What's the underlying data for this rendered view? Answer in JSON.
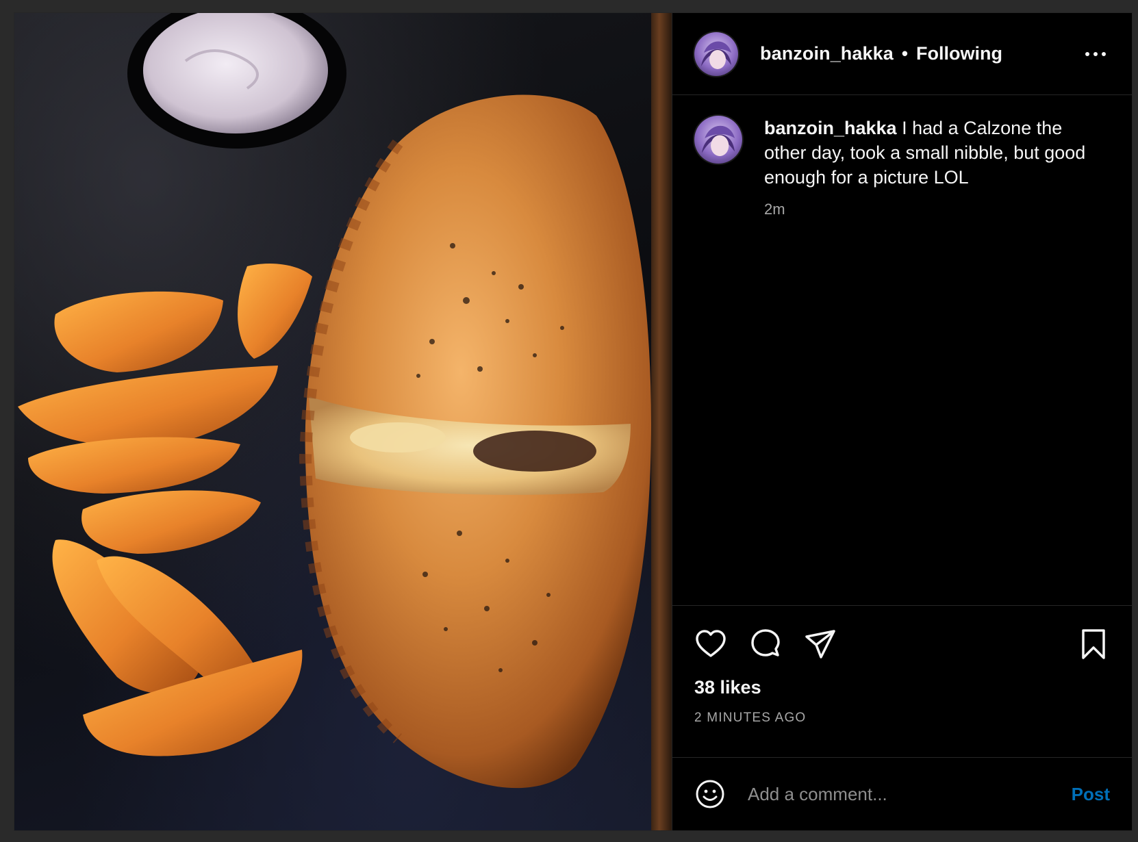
{
  "header": {
    "username": "banzoin_hakka",
    "separator": "•",
    "follow_status": "Following"
  },
  "caption": {
    "username": "banzoin_hakka",
    "text": "I had a Calzone the other day, took a small nibble, but good enough for a picture LOL",
    "time": "2m"
  },
  "engagement": {
    "likes": "38 likes",
    "posted_ago": "2 MINUTES AGO"
  },
  "comment": {
    "placeholder": "Add a comment...",
    "post_label": "Post"
  },
  "colors": {
    "background": "#000000",
    "divider": "#262626",
    "accent": "#0095f6",
    "muted_text": "#a8a8a8"
  },
  "icons": {
    "like": "heart-icon",
    "comment": "comment-bubble-icon",
    "share": "paper-plane-icon",
    "save": "bookmark-icon",
    "more": "more-options-icon",
    "emoji": "emoji-smile-icon"
  }
}
